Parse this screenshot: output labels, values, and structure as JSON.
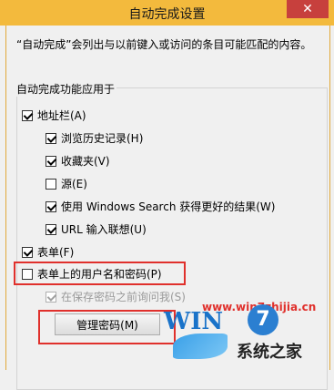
{
  "window": {
    "title": "自动完成设置",
    "close_glyph": "✕"
  },
  "description": "“自动完成”会列出与以前键入或访问的条目可能匹配的内容。",
  "group": {
    "label": "自动完成功能应用于",
    "items": [
      {
        "label": "地址栏(A)",
        "checked": true
      },
      {
        "label": "浏览历史记录(H)",
        "checked": true
      },
      {
        "label": "收藏夹(V)",
        "checked": true
      },
      {
        "label": "源(E)",
        "checked": false
      },
      {
        "label": "使用 Windows Search 获得更好的结果(W)",
        "checked": true
      },
      {
        "label": "URL 输入联想(U)",
        "checked": true
      },
      {
        "label": "表单(F)",
        "checked": true
      },
      {
        "label": "表单上的用户名和密码(P)",
        "checked": false
      },
      {
        "label": "在保存密码之前询问我(S)",
        "checked": true,
        "disabled": true
      }
    ]
  },
  "manage_button": "管理密码(M)",
  "watermark": {
    "url": "www.win7zhijia.cn",
    "logo_latin": "WIN",
    "logo_seven": "7",
    "logo_cn": "系统之家"
  },
  "colors": {
    "titlebar": "#f3ba3d",
    "close": "#c7403d",
    "highlight": "#e0302c"
  }
}
